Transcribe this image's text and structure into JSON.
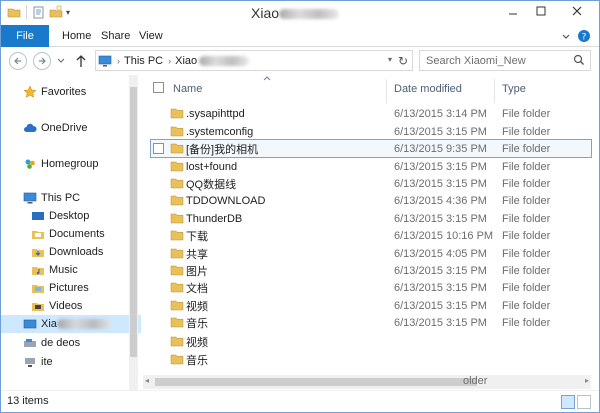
{
  "window": {
    "title": "Xiao"
  },
  "tabs": {
    "file": "File",
    "home": "Home",
    "share": "Share",
    "view": "View"
  },
  "address": {
    "root": "This PC",
    "current": "Xiao"
  },
  "search": {
    "placeholder": "Search Xiaomi_New"
  },
  "nav": {
    "favorites": "Favorites",
    "onedrive": "OneDrive",
    "homegroup": "Homegroup",
    "thispc": "This PC",
    "desktop": "Desktop",
    "documents": "Documents",
    "downloads": "Downloads",
    "music": "Music",
    "pictures": "Pictures",
    "videos": "Videos",
    "selected": "Xia",
    "extra1": "de    deos",
    "extra2": "ite"
  },
  "columns": {
    "name": "Name",
    "date": "Date modified",
    "type": "Type"
  },
  "files": [
    {
      "name": ".sysapihttpd",
      "date": "6/13/2015 3:14 PM",
      "type": "File folder"
    },
    {
      "name": ".systemconfig",
      "date": "6/13/2015 3:15 PM",
      "type": "File folder"
    },
    {
      "name": "[备份]我的相机",
      "date": "6/13/2015 9:35 PM",
      "type": "File folder"
    },
    {
      "name": "lost+found",
      "date": "6/13/2015 3:15 PM",
      "type": "File folder"
    },
    {
      "name": "QQ数据线",
      "date": "6/13/2015 3:15 PM",
      "type": "File folder"
    },
    {
      "name": "TDDOWNLOAD",
      "date": "6/13/2015 4:36 PM",
      "type": "File folder"
    },
    {
      "name": "ThunderDB",
      "date": "6/13/2015 3:15 PM",
      "type": "File folder"
    },
    {
      "name": "下载",
      "date": "6/13/2015 10:16 PM",
      "type": "File folder"
    },
    {
      "name": "共享",
      "date": "6/13/2015 4:05 PM",
      "type": "File folder"
    },
    {
      "name": "图片",
      "date": "6/13/2015 3:15 PM",
      "type": "File folder"
    },
    {
      "name": "文档",
      "date": "6/13/2015 3:15 PM",
      "type": "File folder"
    },
    {
      "name": "视频",
      "date": "6/13/2015 3:15 PM",
      "type": "File folder"
    },
    {
      "name": "音乐",
      "date": "6/13/2015 3:15 PM",
      "type": "File folder"
    },
    {
      "name": "视频",
      "date": "",
      "type": ""
    },
    {
      "name": "音乐",
      "date": "",
      "type": ""
    }
  ],
  "hscroll_label": "older",
  "status": {
    "count": "13 items"
  },
  "colors": {
    "accent": "#1979ca",
    "selection": "#cde8ff",
    "folder": "#e8c15a"
  }
}
